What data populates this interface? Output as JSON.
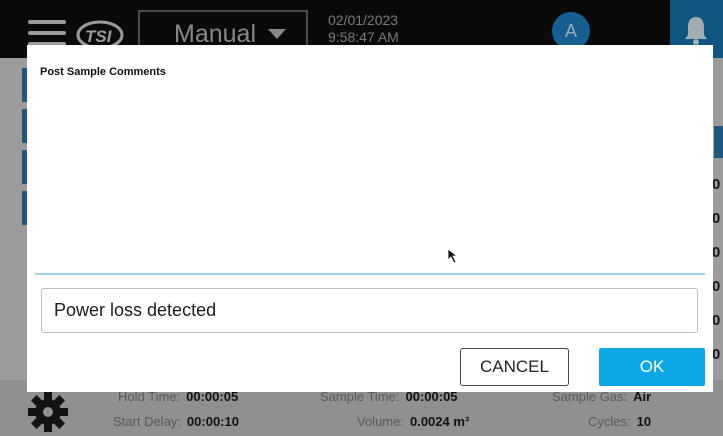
{
  "header": {
    "menu_icon": "hamburger-menu-icon",
    "logo_text": "TSI",
    "mode": {
      "selected": "Manual"
    },
    "date": "02/01/2023",
    "time": "9:58:47 AM",
    "user_initial": "A",
    "notification_icon": "bell-icon"
  },
  "background": {
    "right_values": [
      "0",
      "0",
      "0",
      "0",
      "0",
      "0"
    ],
    "footer": {
      "settings_icon": "gear-icon",
      "hold_time": {
        "label": "Hold Time:",
        "value": "00:00:05"
      },
      "start_delay": {
        "label": "Start Delay:",
        "value": "00:00:10"
      },
      "sample_time": {
        "label": "Sample Time:",
        "value": "00:00:05"
      },
      "volume": {
        "label": "Volume:",
        "value": "0.0024 m³"
      },
      "sample_gas": {
        "label": "Sample Gas:",
        "value": "Air"
      },
      "cycles": {
        "label": "Cycles:",
        "value": "10"
      }
    }
  },
  "dialog": {
    "title": "Post Sample Comments",
    "comment_value": "Power loss detected",
    "cancel_label": "CANCEL",
    "ok_label": "OK"
  },
  "colors": {
    "accent": "#0ea7e6",
    "avatar": "#1e86c8",
    "header_bg": "#0e0e0e",
    "divider": "#9fd3e2"
  }
}
